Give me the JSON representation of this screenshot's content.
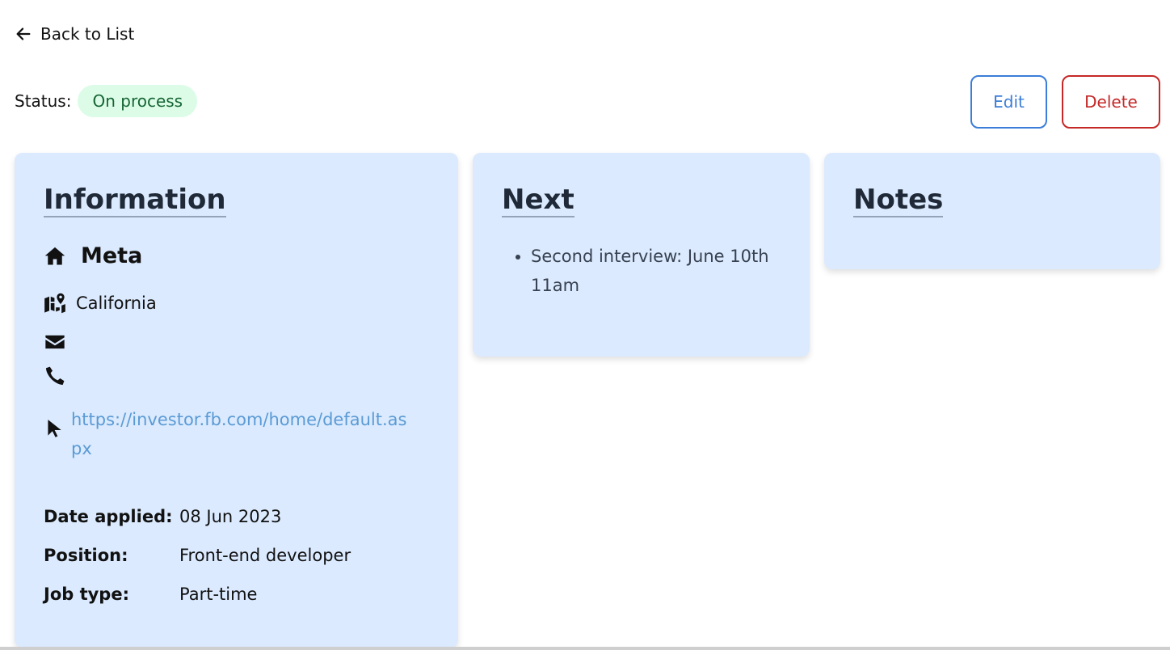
{
  "nav": {
    "back_label": "Back to List",
    "back_icon": "arrow-left-icon"
  },
  "status": {
    "label": "Status:",
    "value": "On process",
    "badge_bg": "#dcfce7",
    "badge_color": "#166534"
  },
  "actions": {
    "edit_label": "Edit",
    "edit_color": "#3b7dd8",
    "delete_label": "Delete",
    "delete_color": "#c62828"
  },
  "information": {
    "title": "Information",
    "company": "Meta",
    "location": "California",
    "email": "",
    "phone": "",
    "website": "https://investor.fb.com/home/default.aspx",
    "details": [
      {
        "label": "Date applied:",
        "value": "08 Jun 2023"
      },
      {
        "label": "Position:",
        "value": "Front-end developer"
      },
      {
        "label": "Job type:",
        "value": "Part-time"
      }
    ],
    "icons": [
      "home-icon",
      "map-location-icon",
      "envelope-icon",
      "phone-icon",
      "pointer-icon"
    ]
  },
  "next": {
    "title": "Next",
    "items": [
      "Second interview: June 10th 11am"
    ]
  },
  "notes": {
    "title": "Notes"
  },
  "colors": {
    "card_bg": "#dbeafe",
    "link": "#5b9bd5"
  }
}
